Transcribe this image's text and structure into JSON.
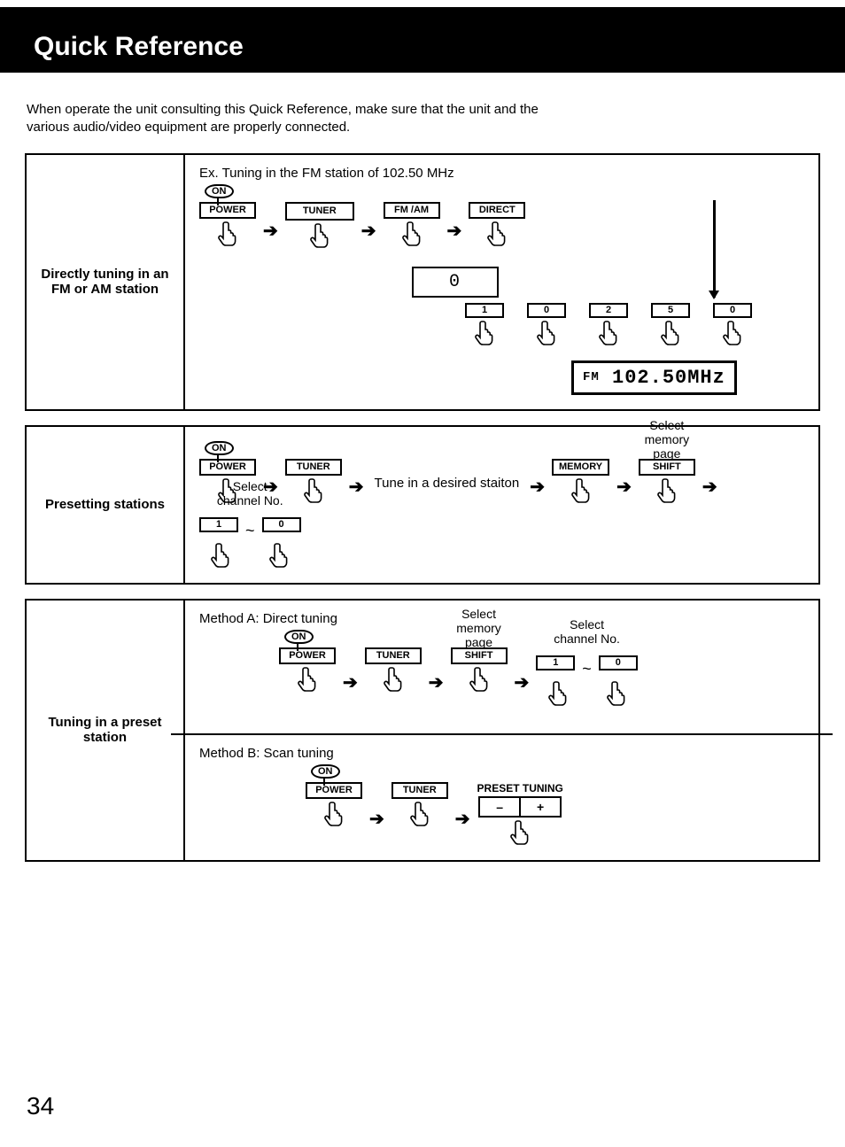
{
  "header": {
    "title": "Quick Reference"
  },
  "intro": "When operate the unit consulting this Quick Reference, make sure that the unit and the various audio/video equipment are properly connected.",
  "labels": {
    "on": "ON",
    "power": "POWER",
    "tuner": "TUNER",
    "fmam": "FM /AM",
    "direct": "DIRECT",
    "memory": "MEMORY",
    "shift": "SHIFT",
    "preset_tuning": "PRESET TUNING",
    "minus": "–",
    "plus": "+"
  },
  "panel1": {
    "title": "Directly tuning in an FM or AM station",
    "example": "Ex. Tuning in the FM station of 102.50 MHz",
    "digit_display": "0",
    "freq": "102.50MHz",
    "digits": [
      "1",
      "0",
      "2",
      "5",
      "0"
    ]
  },
  "panel2": {
    "title": "Presetting stations",
    "tune_text": "Tune in a desired staiton",
    "cap_mem": "Select memory page",
    "cap_ch": "Select channel No.",
    "ch_from": "1",
    "ch_to": "0"
  },
  "panel3": {
    "title": "Tuning in a preset station",
    "methodA": "Method A: Direct tuning",
    "methodB": "Method B: Scan tuning",
    "cap_mem": "Select memory page",
    "cap_ch": "Select channel No.",
    "ch_from": "1",
    "ch_to": "0"
  },
  "page_number": "34"
}
